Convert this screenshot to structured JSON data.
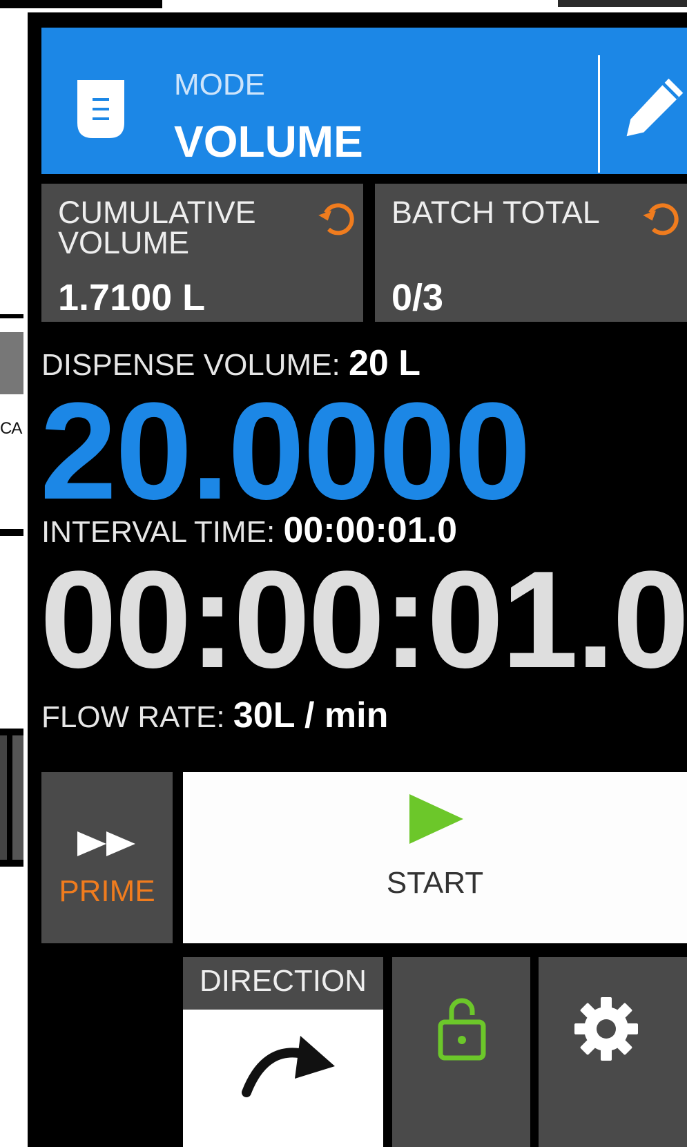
{
  "background": {
    "fragment_text": "CA"
  },
  "mode": {
    "label": "MODE",
    "value": "VOLUME"
  },
  "cards": {
    "cumulative": {
      "label_line1": "CUMULATIVE",
      "label_line2": "VOLUME",
      "value": "1.7100 L"
    },
    "batch": {
      "label": "BATCH TOTAL",
      "value": "0/3"
    }
  },
  "dispense": {
    "label": "DISPENSE VOLUME:",
    "setting": "20 L",
    "display": "20.0000"
  },
  "interval": {
    "label": "INTERVAL TIME:",
    "setting": "00:00:01.0",
    "display": "00:00:01.0"
  },
  "flow": {
    "label": "FLOW RATE:",
    "value": "30L / min"
  },
  "controls": {
    "prime_label": "PRIME",
    "start_label": "START",
    "direction_label": "DIRECTION"
  },
  "colors": {
    "accent_blue": "#1c87e6",
    "prime_orange": "#f07c1e",
    "play_green": "#6cc72a",
    "panel_grey": "#4a4a4a"
  },
  "icons": [
    "document-icon",
    "edit-icon",
    "reset-icon",
    "fast-forward-icon",
    "play-icon",
    "direction-arrow-icon",
    "unlock-icon",
    "gear-icon"
  ]
}
